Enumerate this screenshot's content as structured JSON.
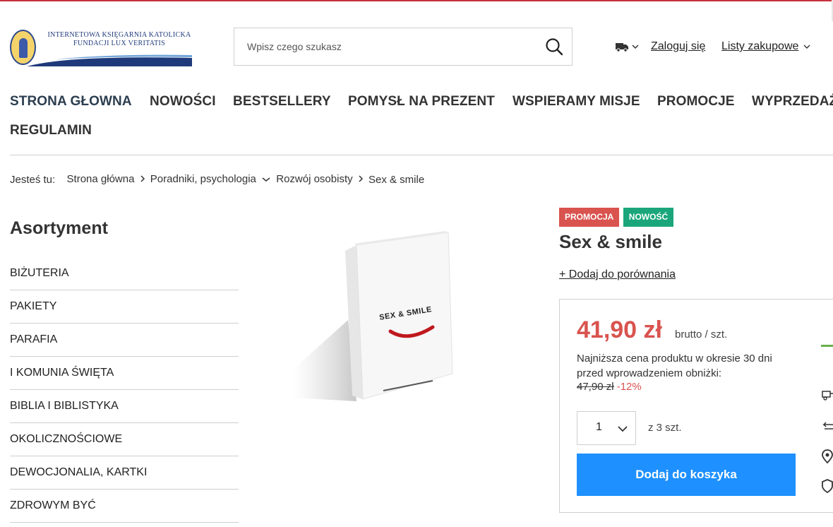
{
  "header": {
    "logo_line1": "INTERNETOWA KSIĘGARNIA KATOLICKA",
    "logo_line2": "FUNDACJI LUX VERITATIS",
    "search_placeholder": "Wpisz czego szukasz",
    "login_label": "Zaloguj się",
    "lists_label": "Listy zakupowe"
  },
  "nav": {
    "items": [
      "STRONA GŁOWNA",
      "NOWOŚCI",
      "BESTSELLERY",
      "POMYSŁ NA PREZENT",
      "WSPIERAMY MISJE",
      "PROMOCJE",
      "WYPRZEDAŻ",
      "REGULAMIN"
    ]
  },
  "breadcrumb": {
    "prefix": "Jesteś tu:",
    "items": [
      "Strona główna",
      "Poradniki, psychologia",
      "Rozwój osobisty",
      "Sex & smile"
    ]
  },
  "sidebar": {
    "title": "Asortyment",
    "items": [
      "BIŻUTERIA",
      "PAKIETY",
      "PARAFIA",
      "I KOMUNIA ŚWIĘTA",
      "BIBLIA I BIBLISTYKA",
      "OKOLICZNOŚCIOWE",
      "DEWOCJONALIA, KARTKI",
      "ZDROWYM BYĆ"
    ]
  },
  "product": {
    "badge_promo": "PROMOCJA",
    "badge_new": "NOWOŚĆ",
    "title": "Sex & smile",
    "compare_label": "+ Dodaj do porównania",
    "price": "41,90 zł",
    "price_unit": "brutto / szt.",
    "lowest_price_note": "Najniższa cena produktu w okresie 30 dni przed wprowadzeniem obniżki:",
    "old_price": "47,90 zł",
    "discount": "-12%",
    "quantity": "1",
    "stock": "z 3 szt.",
    "add_to_cart": "Dodaj do koszyka",
    "book_cover_title": "SEX & SMILE"
  },
  "colors": {
    "accent": "#1e90ff",
    "promo": "#d9534f",
    "new": "#1aa67a"
  }
}
